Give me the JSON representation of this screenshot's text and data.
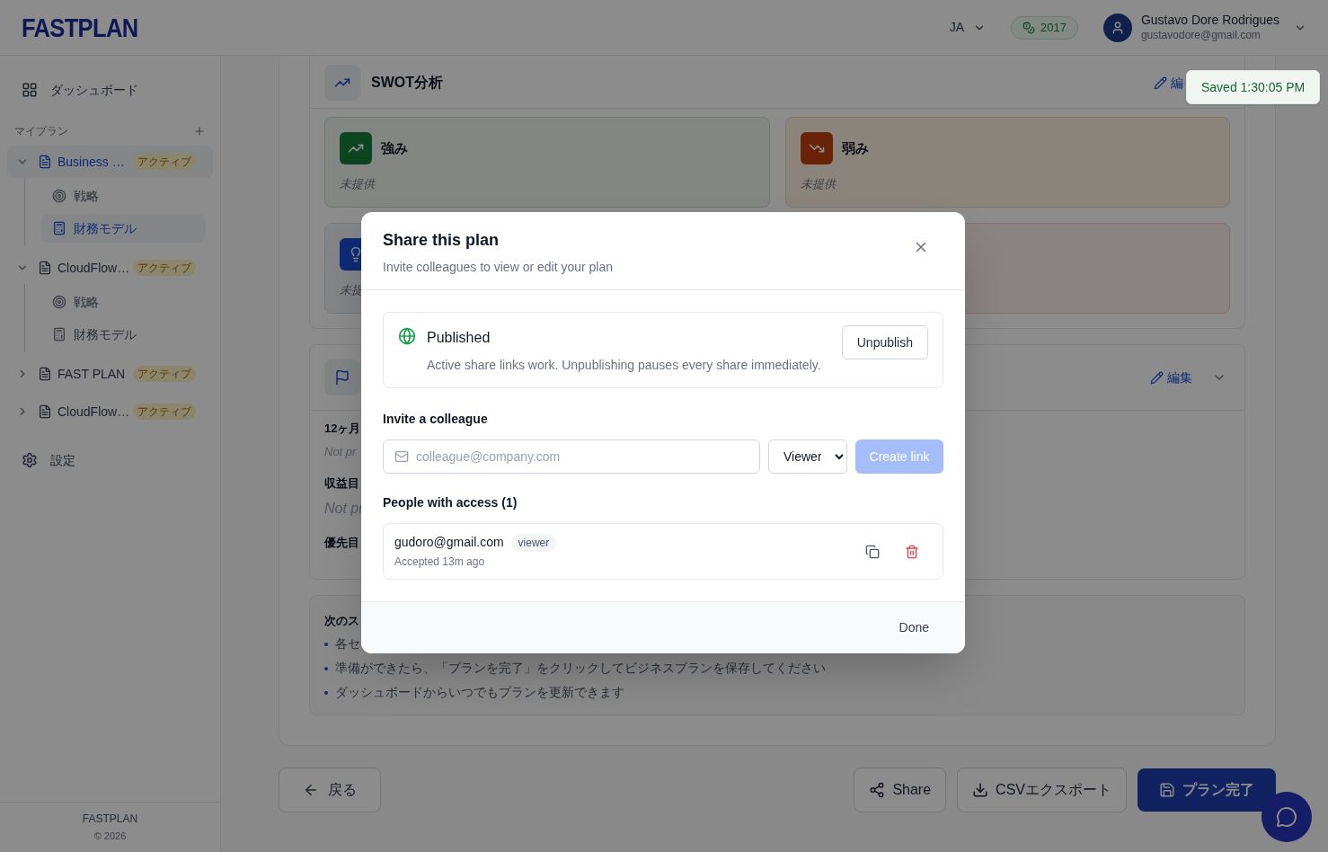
{
  "header": {
    "logo": "FASTPLAN",
    "language": "JA",
    "credits": "2017",
    "user": {
      "name": "Gustavo Dore Rodrigues",
      "email": "gustavodore@gmail.com"
    }
  },
  "sidebar": {
    "dashboard": "ダッシュボード",
    "section_title": "マイプラン",
    "plans": [
      {
        "name": "Business …",
        "badge": "アクティブ",
        "expanded": true,
        "selected": true,
        "children": [
          {
            "label": "戦略",
            "kind": "strategy",
            "selected": false
          },
          {
            "label": "財務モデル",
            "kind": "finance",
            "selected": true
          }
        ]
      },
      {
        "name": "CloudFlow…",
        "badge": "アクティブ",
        "expanded": true,
        "selected": false,
        "children": [
          {
            "label": "戦略",
            "kind": "strategy",
            "selected": false
          },
          {
            "label": "財務モデル",
            "kind": "finance",
            "selected": false
          }
        ]
      },
      {
        "name": "FAST PLAN",
        "badge": "アクティブ",
        "expanded": false,
        "selected": false
      },
      {
        "name": "CloudFlow…",
        "badge": "アクティブ",
        "expanded": false,
        "selected": false
      }
    ],
    "settings": "設定",
    "footer": {
      "brand": "FASTPLAN",
      "copyright": "© 2026"
    }
  },
  "swot": {
    "title": "SWOT分析",
    "edit": "編",
    "cards": [
      {
        "kind": "strength",
        "title": "強み",
        "body": "未提供"
      },
      {
        "kind": "weakness",
        "title": "弱み",
        "body": "未提供"
      },
      {
        "kind": "opportunity",
        "body": "未提"
      },
      {
        "kind": "threat"
      }
    ]
  },
  "goals": {
    "edit": "編集",
    "fields": [
      {
        "label": "12ヶ月",
        "value": "Not pr",
        "kind": "short"
      },
      {
        "label": "収益目",
        "value": "Not pr",
        "kind": "long"
      },
      {
        "label": "優先目"
      }
    ]
  },
  "next_steps": {
    "title": "次のス",
    "items": [
      "各セ",
      "準備ができたら、「プランを完了」をクリックしてビジネスプランを保存してください",
      "ダッシュボードからいつでもプランを更新できます"
    ]
  },
  "actions": {
    "back": "戻る",
    "share": "Share",
    "export": "CSVエクスポート",
    "finish": "プラン完了"
  },
  "toast": "Saved 1:30:05 PM",
  "dialog": {
    "title": "Share this plan",
    "subtitle": "Invite colleagues to view or edit your plan",
    "status": {
      "published": true,
      "title": "Published",
      "description": "Active share links work. Unpublishing pauses every share immediately.",
      "button": "Unpublish"
    },
    "invite_label": "Invite a colleague",
    "email_placeholder": "colleague@company.com",
    "role": "Viewer",
    "create_button": {
      "label": "Create link",
      "disabled": true
    },
    "people_label": "People with access (1)",
    "people": [
      {
        "email": "gudoro@gmail.com",
        "role": "viewer",
        "status": "Accepted 13m ago"
      }
    ],
    "done": "Done"
  }
}
